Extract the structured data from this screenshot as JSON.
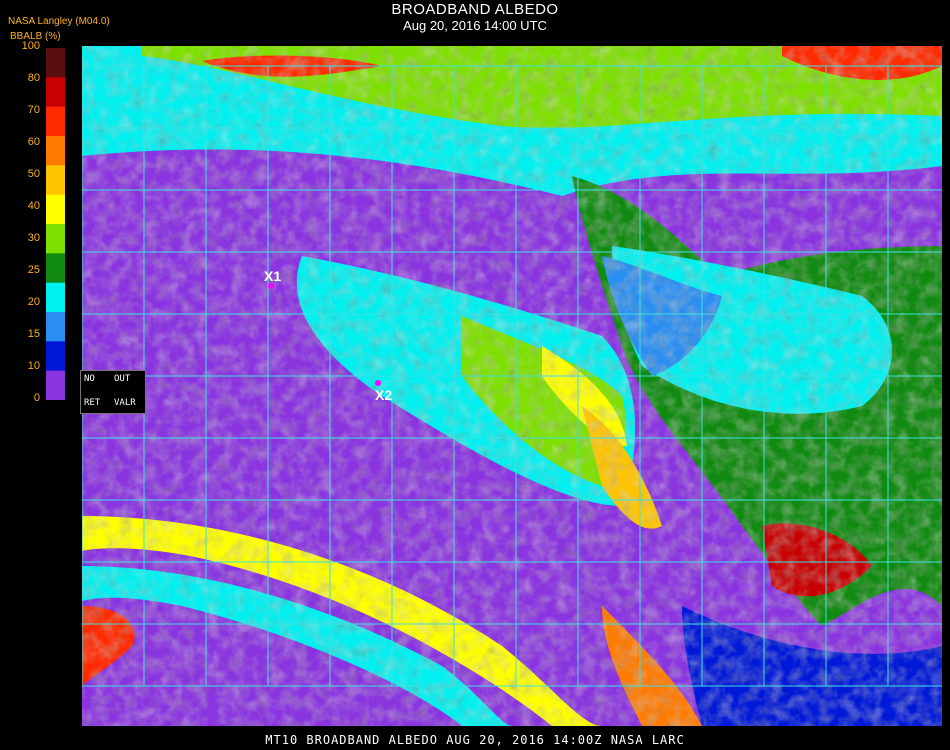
{
  "header": {
    "title": "BROADBAND ALBEDO",
    "subtitle": "Aug 20, 2016 14:00 UTC",
    "org_label": "NASA Langley (M04.0)",
    "units_label": "BBALB (%)"
  },
  "colorbar": {
    "ticks": [
      "100",
      "80",
      "70",
      "60",
      "50",
      "40",
      "30",
      "25",
      "20",
      "15",
      "10",
      "0"
    ],
    "colors": [
      "#5a0e0e",
      "#c80000",
      "#ff2a00",
      "#ff7a00",
      "#ffc400",
      "#ffff00",
      "#7ee000",
      "#108a10",
      "#00f0f0",
      "#2a8ef0",
      "#0018d8",
      "#8a34e0"
    ]
  },
  "map": {
    "grid_color": "#40e0e0",
    "ocean_color": "#8a34e0",
    "land_color": "#108a10"
  },
  "legend_box": {
    "no": "NO",
    "out": "OUT",
    "ret": "RET",
    "valr": "VALR"
  },
  "markers": [
    {
      "label": "X1"
    },
    {
      "label": "X2"
    }
  ],
  "footer": {
    "text": "MT10  BROADBAND ALBEDO   AUG 20, 2016 14:00Z   NASA LARC"
  }
}
